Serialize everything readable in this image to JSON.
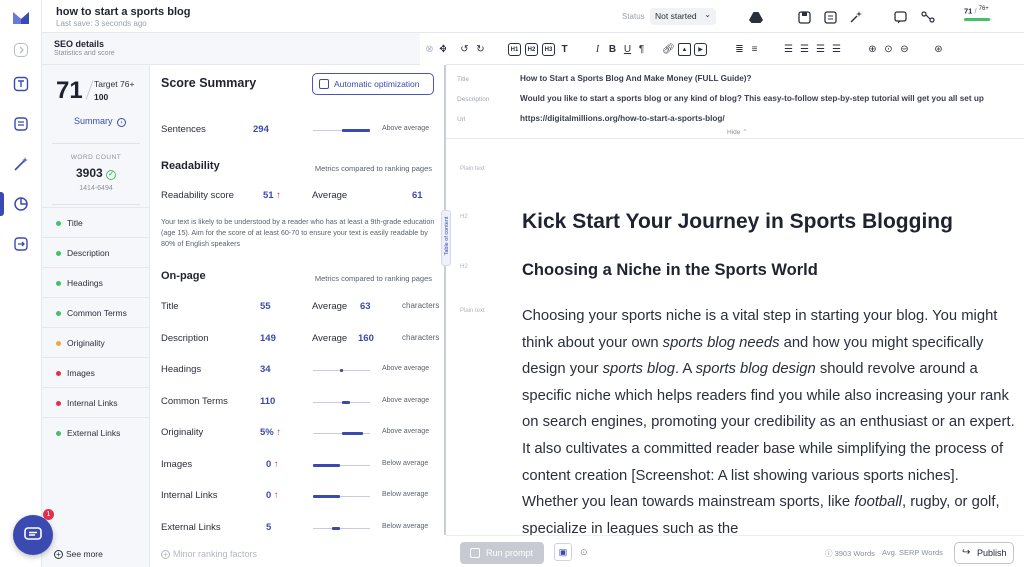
{
  "app": {
    "brand_color": "#3b4ab0",
    "accent_green": "#45c06a"
  },
  "header": {
    "doc_title": "how to start a sports blog",
    "last_save": "Last save: 3 seconds ago",
    "status_label": "Status",
    "status_value": "Not started",
    "score_mini": "71",
    "score_mini_target": "76+",
    "score_mini_fraction": 0.93
  },
  "seo": {
    "title": "SEO details",
    "subtitle": "Statistics and score"
  },
  "left": {
    "score": "71",
    "target_label": "Target 76+",
    "target_value": "100",
    "summary_link": "Summary",
    "word_count_label": "WORD COUNT",
    "word_count": "3903",
    "word_range": "1414-6494",
    "nav": [
      {
        "label": "Title",
        "color": "#45c06a"
      },
      {
        "label": "Description",
        "color": "#45c06a"
      },
      {
        "label": "Headings",
        "color": "#45c06a"
      },
      {
        "label": "Common Terms",
        "color": "#45c06a"
      },
      {
        "label": "Originality",
        "color": "#f2a93b"
      },
      {
        "label": "Images",
        "color": "#e0314a"
      },
      {
        "label": "Internal Links",
        "color": "#e0314a"
      },
      {
        "label": "External Links",
        "color": "#45c06a"
      }
    ],
    "see_more": "See more"
  },
  "summary": {
    "title": "Score Summary",
    "auto_button": "Automatic optimization",
    "sentences": {
      "label": "Sentences",
      "value": "294",
      "note": "Above average",
      "bar_start": 0.5,
      "bar_end": 1.0
    },
    "readability_title": "Readability",
    "readability_note": "Metrics compared to ranking pages",
    "readability": {
      "label": "Readability score",
      "value": "51",
      "avg_label": "Average",
      "avg_value": "61"
    },
    "readability_text": "Your text is likely to be understood by a reader who has at least a 9th-grade education (age 15). Aim for the score of at least 60-70 to ensure your text is easily readable by 80% of English speakers",
    "onpage_title": "On-page",
    "onpage_note": "Metrics compared to ranking pages",
    "rows": [
      {
        "label": "Title",
        "value": "55",
        "avg_label": "Average",
        "avg_value": "63",
        "unit": "characters"
      },
      {
        "label": "Description",
        "value": "149",
        "avg_label": "Average",
        "avg_value": "160",
        "unit": "characters"
      },
      {
        "label": "Headings",
        "value": "34",
        "note": "Above average",
        "bar_start": 0.48,
        "bar_end": 0.52
      },
      {
        "label": "Common Terms",
        "value": "110",
        "note": "Above average",
        "bar_start": 0.5,
        "bar_end": 0.65
      },
      {
        "label": "Originality",
        "value": "5%",
        "note": "Above average",
        "bar_start": 0.5,
        "bar_end": 0.88
      },
      {
        "label": "Images",
        "value": "0",
        "note": "Below average",
        "bar_start": 0.0,
        "bar_end": 0.48
      },
      {
        "label": "Internal Links",
        "value": "0",
        "note": "Below average",
        "bar_start": 0.0,
        "bar_end": 0.48
      },
      {
        "label": "External Links",
        "value": "5",
        "note": "Below average",
        "bar_start": 0.33,
        "bar_end": 0.48
      }
    ],
    "minor": "Minor ranking factors"
  },
  "meta": {
    "title_label": "Title",
    "title_value": "How to Start a Sports Blog And Make Money (FULL Guide)?",
    "desc_label": "Description",
    "desc_value": "Would you like to start a sports blog or any kind of blog? This easy-to-follow step-by-step tutorial will get you all set up",
    "url_label": "Url",
    "url_value": "https://digitalmillions.org/how-to-start-a-sports-blog/",
    "hide": "Hide"
  },
  "toc": "Table of content",
  "editor": {
    "plain1": "Plain text",
    "h2a": "H2",
    "h1": "Kick Start Your Journey in Sports Blogging",
    "h2b": "H2",
    "h2": "Choosing a Niche in the Sports World",
    "plain2": "Plain text",
    "para_parts": [
      {
        "t": "Choosing your sports niche is a vital step in starting your blog. You might think about your own "
      },
      {
        "t": "sports blog needs",
        "i": true
      },
      {
        "t": " and how you might specifically design your "
      },
      {
        "t": "sports blog",
        "i": true
      },
      {
        "t": ". A "
      },
      {
        "t": "sports blog design",
        "i": true
      },
      {
        "t": " should revolve around a specific niche which helps readers find you while also increasing your rank on search engines, promoting your credibility as an enthusiast or an expert. It also cultivates a committed reader base while simplifying the process of content creation [Screenshot: A list showing various sports niches]. Whether you lean towards mainstream sports, like "
      },
      {
        "t": "football",
        "i": true
      },
      {
        "t": ", rugby, or golf, specialize in leagues such as the"
      }
    ]
  },
  "bottom": {
    "run_prompt": "Run prompt",
    "word_count": "3903 Words",
    "avg_serp": "Avg. SERP Words",
    "publish": "Publish"
  },
  "chat_badge": "1"
}
